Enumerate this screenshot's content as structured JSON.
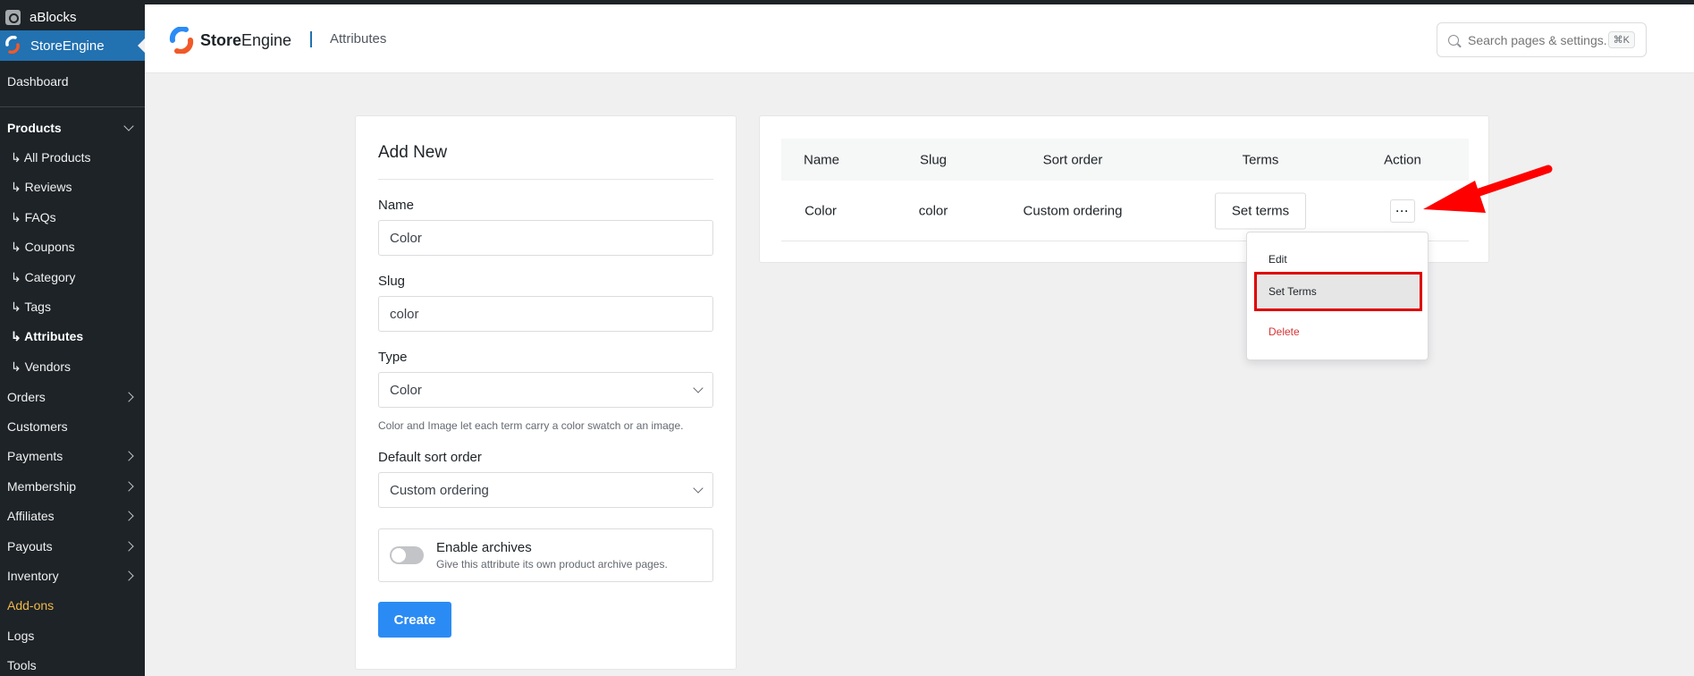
{
  "sidebar": {
    "site_name": "aBlocks",
    "active_plugin": "StoreEngine",
    "items": {
      "dashboard": "Dashboard",
      "products": "Products",
      "all_products": "↳ All Products",
      "reviews": "↳ Reviews",
      "faqs": "↳ FAQs",
      "coupons": "↳ Coupons",
      "category": "↳ Category",
      "tags": "↳ Tags",
      "attributes": "↳ Attributes",
      "vendors": "↳ Vendors",
      "orders": "Orders",
      "customers": "Customers",
      "payments": "Payments",
      "membership": "Membership",
      "affiliates": "Affiliates",
      "payouts": "Payouts",
      "inventory": "Inventory",
      "addons": "Add-ons",
      "logs": "Logs",
      "tools": "Tools"
    },
    "addons_color": "#f0b849",
    "active_bg": "#2271b1"
  },
  "header": {
    "brand_bold": "Store",
    "brand_thin": "Engine",
    "breadcrumb": "Attributes",
    "search_placeholder": "Search pages & settings...",
    "shortcut": "⌘K"
  },
  "form": {
    "title": "Add New",
    "name_label": "Name",
    "name_value": "Color",
    "slug_label": "Slug",
    "slug_value": "color",
    "type_label": "Type",
    "type_value": "Color",
    "type_help": "Color and Image let each term carry a color swatch or an image.",
    "sort_label": "Default sort order",
    "sort_value": "Custom ordering",
    "archives_title": "Enable archives",
    "archives_desc": "Give this attribute its own product archive pages.",
    "create_label": "Create",
    "accent": "#2b8bf5"
  },
  "table": {
    "columns": [
      "Name",
      "Slug",
      "Sort order",
      "Terms",
      "Action"
    ],
    "rows": [
      {
        "name": "Color",
        "slug": "color",
        "sort": "Custom ordering",
        "terms_button": "Set terms",
        "action_icon": "ellipsis-icon"
      }
    ]
  },
  "action_menu": {
    "edit": "Edit",
    "set_terms": "Set Terms",
    "delete": "Delete",
    "highlight_color": "#e00000"
  }
}
